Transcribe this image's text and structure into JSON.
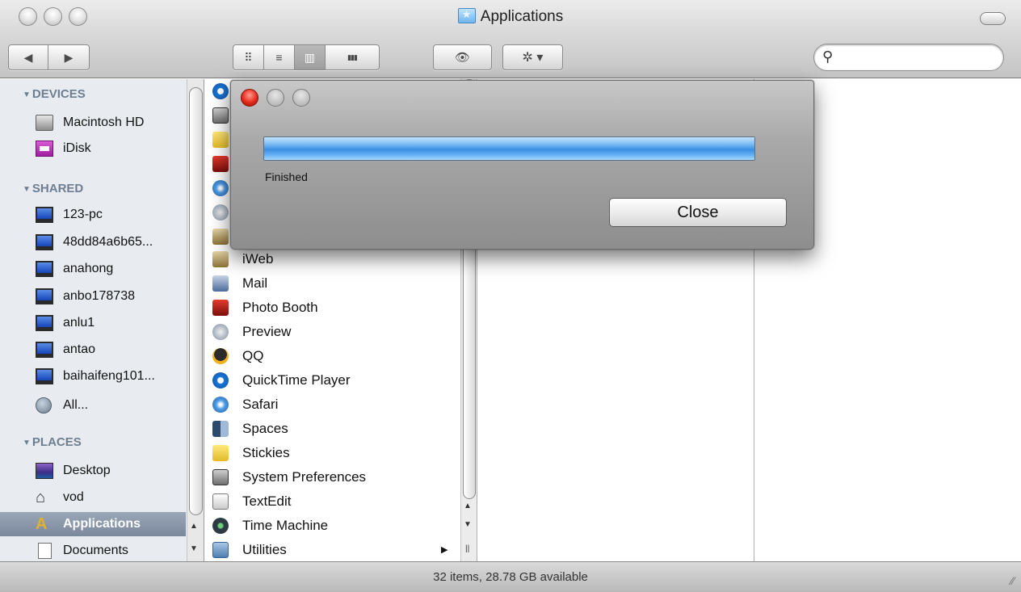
{
  "window": {
    "title": "Applications",
    "title_icon": "applications-folder-icon"
  },
  "toolbar": {
    "back_glyph": "◀",
    "forward_glyph": "▶",
    "view_icon_glyph": "⠿",
    "view_list_glyph": "≡",
    "view_column_glyph": "▥",
    "view_cover_glyph": "▮▮▮",
    "quicklook_glyph": "👁",
    "action_glyph": "✲ ▾",
    "search_glyph": "⚲",
    "search_value": "",
    "search_placeholder": ""
  },
  "sidebar": {
    "devices_header": "DEVICES",
    "devices": [
      {
        "label": "Macintosh HD",
        "icon": "hard-drive-icon"
      },
      {
        "label": "iDisk",
        "icon": "idisk-icon"
      }
    ],
    "shared_header": "SHARED",
    "shared": [
      {
        "label": "123-pc",
        "icon": "pc-icon"
      },
      {
        "label": "48dd84a6b65...",
        "icon": "pc-icon"
      },
      {
        "label": "anahong",
        "icon": "pc-icon"
      },
      {
        "label": "anbo178738",
        "icon": "pc-icon"
      },
      {
        "label": "anlu1",
        "icon": "pc-icon"
      },
      {
        "label": "antao",
        "icon": "pc-icon"
      },
      {
        "label": "baihaifeng101...",
        "icon": "pc-icon"
      },
      {
        "label": "All...",
        "icon": "network-globe-icon"
      }
    ],
    "places_header": "PLACES",
    "places": [
      {
        "label": "Desktop",
        "icon": "desktop-icon"
      },
      {
        "label": "vod",
        "icon": "home-icon"
      },
      {
        "label": "Applications",
        "icon": "applications-icon",
        "selected": true
      },
      {
        "label": "Documents",
        "icon": "documents-icon"
      }
    ]
  },
  "applications": [
    {
      "label": "iWeb",
      "icon": "iweb-icon"
    },
    {
      "label": "Mail",
      "icon": "mail-icon"
    },
    {
      "label": "Photo Booth",
      "icon": "photo-booth-icon"
    },
    {
      "label": "Preview",
      "icon": "preview-icon"
    },
    {
      "label": "QQ",
      "icon": "qq-icon"
    },
    {
      "label": "QuickTime Player",
      "icon": "quicktime-icon"
    },
    {
      "label": "Safari",
      "icon": "safari-icon"
    },
    {
      "label": "Spaces",
      "icon": "spaces-icon"
    },
    {
      "label": "Stickies",
      "icon": "stickies-icon"
    },
    {
      "label": "System Preferences",
      "icon": "system-preferences-icon"
    },
    {
      "label": "TextEdit",
      "icon": "textedit-icon"
    },
    {
      "label": "Time Machine",
      "icon": "time-machine-icon"
    },
    {
      "label": "Utilities",
      "icon": "utilities-folder-icon",
      "has_children": true,
      "arrow": "▶"
    }
  ],
  "status_bar": {
    "text": "32 items, 28.78 GB available"
  },
  "dialog": {
    "progress_fraction": 1.0,
    "status": "Finished",
    "close_label": "Close"
  },
  "colors": {
    "progress_fill": "#3a8ee4",
    "selection": "#7b899c",
    "close_dot": "#e5291b"
  }
}
